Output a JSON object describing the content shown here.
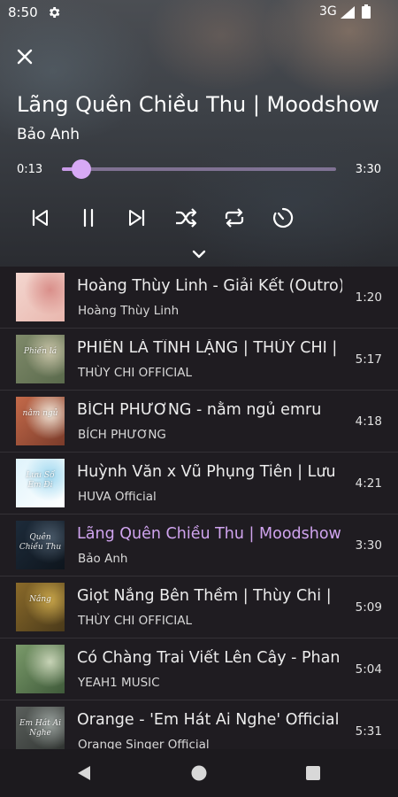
{
  "status_bar": {
    "time": "8:50",
    "network": "3G",
    "icons": [
      "gear-icon",
      "signal-icon",
      "battery-icon"
    ]
  },
  "player": {
    "close_icon": "close-icon",
    "title": "Lãng Quên Chiều Thu | Moodshow",
    "artist": "Bảo Anh",
    "current_time": "0:13",
    "total_time": "3:30",
    "progress": 0.07,
    "controls": [
      "previous-icon",
      "pause-icon",
      "next-icon",
      "shuffle-icon",
      "repeat-icon",
      "sleep-timer-icon"
    ],
    "collapse_icon": "chevron-down-icon"
  },
  "queue": [
    {
      "title": "Hoàng Thùy Linh - Giải Kết (Outro) |",
      "artist": "Hoàng Thùy Linh",
      "duration": "1:20",
      "active": false
    },
    {
      "title": "PHIẾN LÁ TĨNH LẶNG | THÙY CHI |",
      "artist": "THÙY CHI OFFICIAL",
      "duration": "5:17",
      "active": false
    },
    {
      "title": "BÍCH PHƯƠNG - nằm ngủ emru",
      "artist": "BÍCH PHƯƠNG",
      "duration": "4:18",
      "active": false
    },
    {
      "title": "Huỳnh Văn x Vũ Phụng Tiên | Lưu",
      "artist": "HUVA Official",
      "duration": "4:21",
      "active": false
    },
    {
      "title": "Lãng Quên Chiều Thu | Moodshow",
      "artist": "Bảo Anh",
      "duration": "3:30",
      "active": true
    },
    {
      "title": "Giọt Nắng Bên Thềm | Thùy Chi |",
      "artist": "THÙY CHI OFFICIAL",
      "duration": "5:09",
      "active": false
    },
    {
      "title": "Có Chàng Trai Viết Lên Cây - Phan",
      "artist": "YEAH1 MUSIC",
      "duration": "5:04",
      "active": false
    },
    {
      "title": "Orange - 'Em Hát Ai Nghe' Official",
      "artist": "Orange Singer Official",
      "duration": "5:31",
      "active": false
    }
  ],
  "thumb_art": [
    {
      "text": "",
      "colors": [
        "#f3d6cf",
        "#d98f8a",
        "#e9b7ae"
      ]
    },
    {
      "text": "Phiến lá",
      "colors": [
        "#7f8a6a",
        "#c9c4a8",
        "#5a6a4c"
      ]
    },
    {
      "text": "nằm ngủ",
      "colors": [
        "#c46a4a",
        "#f1e6d8",
        "#7a3b2a"
      ]
    },
    {
      "text": "Lưu Số Em Đi",
      "colors": [
        "#dff3fb",
        "#9fd8f0",
        "#ffffff"
      ]
    },
    {
      "text": "Quên Chiều Thu",
      "colors": [
        "#1d2b3a",
        "#4a5a6a",
        "#0e151d"
      ]
    },
    {
      "text": "Nắng",
      "colors": [
        "#8a6a2a",
        "#c9a64a",
        "#4a3a1a"
      ]
    },
    {
      "text": "",
      "colors": [
        "#7a9a6a",
        "#c7d3b6",
        "#3f5a3a"
      ]
    },
    {
      "text": "Em Hát Ai Nghe",
      "colors": [
        "#5a5f5c",
        "#9aa29e",
        "#2e322f"
      ]
    }
  ],
  "nav_bar": {
    "icons": [
      "back-icon",
      "home-icon",
      "recents-icon"
    ]
  },
  "colors": {
    "accent": "#c99be8",
    "active_title": "#d0a4ef",
    "list_background": "#1f1c21"
  }
}
